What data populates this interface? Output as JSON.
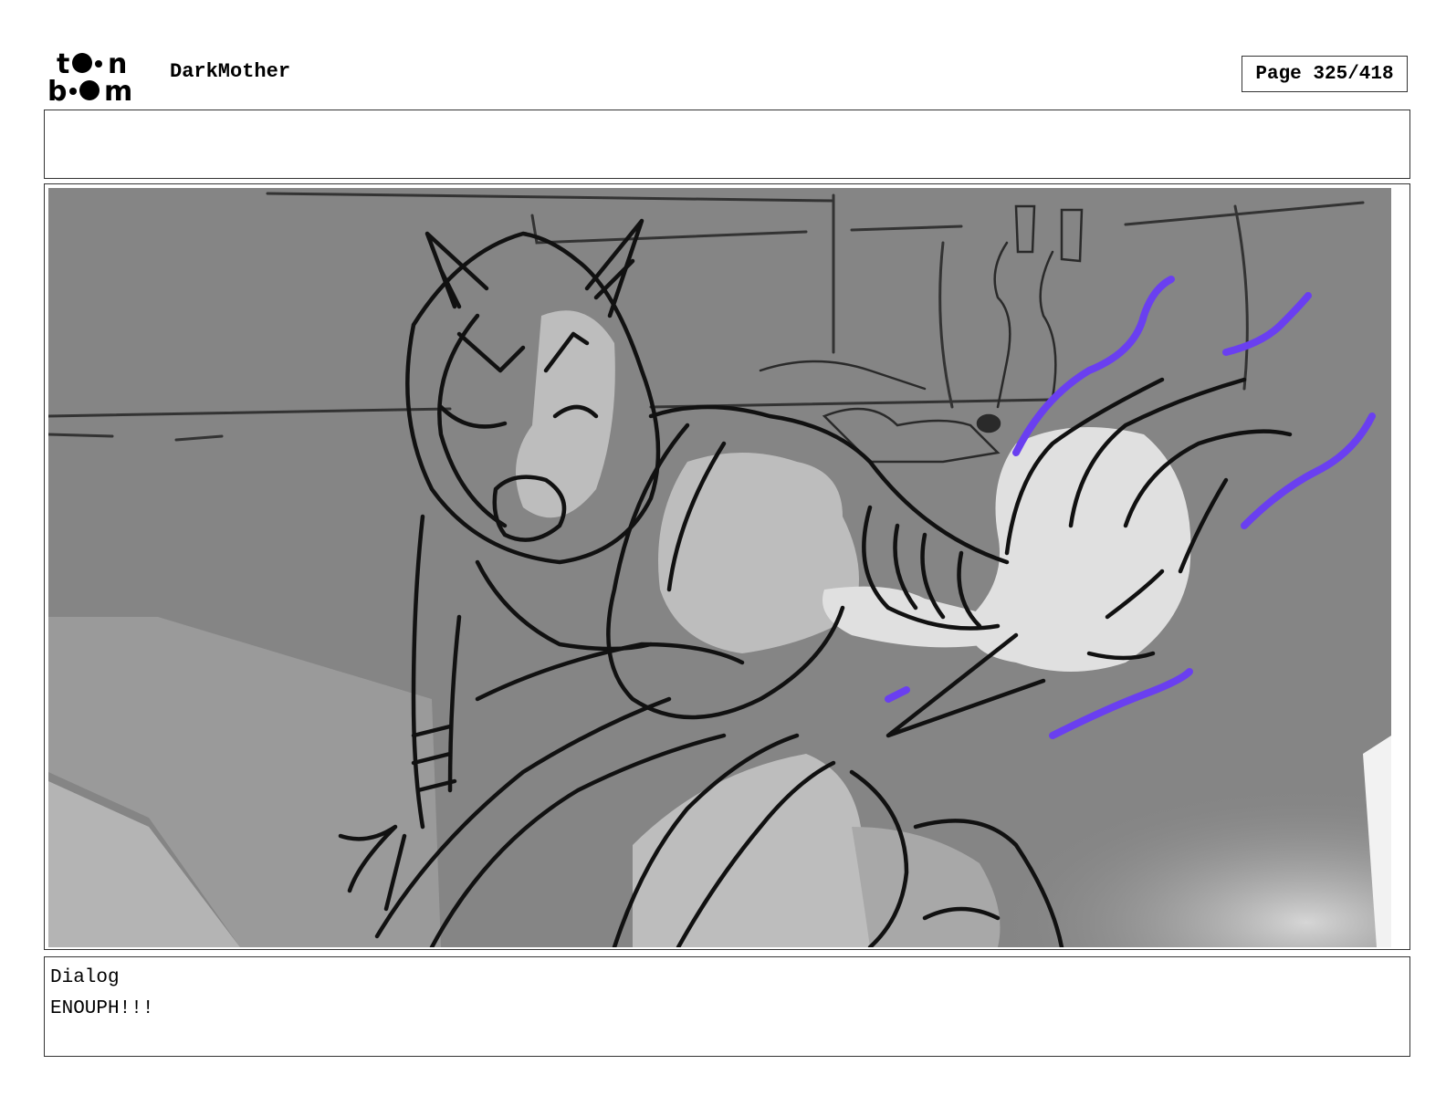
{
  "header": {
    "logo_text": "toon boom",
    "project_title": "DarkMother",
    "page_label": "Page 325/418"
  },
  "notes": {
    "text": ""
  },
  "panel": {
    "colors": {
      "background": "#858585",
      "light": "#bdbdbd",
      "highlight": "#e0e0e0",
      "ink": "#111111",
      "effect": "#6a3ff0"
    }
  },
  "dialog": {
    "label": "Dialog",
    "text": "ENOUPH!!!"
  }
}
